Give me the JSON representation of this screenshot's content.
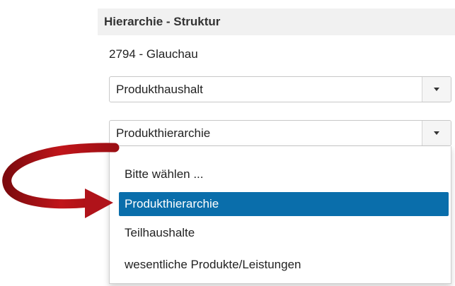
{
  "panel": {
    "title": "Hierarchie - Struktur"
  },
  "unit": {
    "label": "2794 - Glauchau"
  },
  "selects": [
    {
      "value": "Produkthaushalt",
      "icon": "chevron-down-icon"
    },
    {
      "value": "Produkthierarchie",
      "icon": "chevron-down-icon"
    }
  ],
  "dropdown": {
    "options": [
      "Bitte wählen ...",
      "Produkthierarchie",
      "Teilhaushalte",
      "wesentliche Produkte/Leistungen"
    ],
    "highlighted": "Produkthierarchie"
  },
  "colors": {
    "highlight": "#0a6eab",
    "arrow": "#c0151a",
    "header_bg": "#f1f1f1"
  },
  "annotation": {
    "icon": "curved-arrow-icon"
  }
}
